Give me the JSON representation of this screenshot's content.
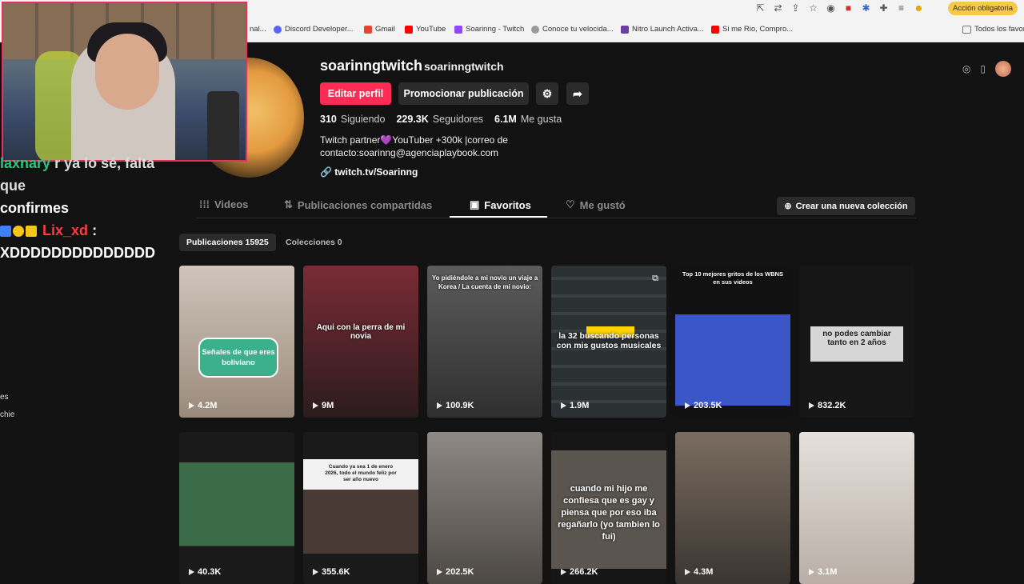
{
  "browser": {
    "action_label": "Acción obligatoria",
    "bookmarks": [
      {
        "label": "nal...",
        "color": "#888"
      },
      {
        "label": "Discord Developer...",
        "color": "#5865f2"
      },
      {
        "label": "Gmail",
        "color": "#ea4335"
      },
      {
        "label": "YouTube",
        "color": "#ff0000"
      },
      {
        "label": "Soarinng - Twitch",
        "color": "#9146ff"
      },
      {
        "label": "Conoce tu velocida...",
        "color": "#999"
      },
      {
        "label": "Nitro Launch Activa...",
        "color": "#6b3fa0"
      },
      {
        "label": "Si me Rio, Compro...",
        "color": "#ff0000"
      },
      {
        "label": "Todos los favori",
        "color": "#777"
      }
    ]
  },
  "chat": {
    "line1_tail": "r ya lo sé, falta que",
    "line2": "confirmes",
    "user2": "Lix_xd",
    "colon": ":",
    "message2": "XDDDDDDDDDDDDDD",
    "side_frag1": "es",
    "side_frag2": "chie"
  },
  "profile": {
    "username": "soarinngtwitch",
    "handle": "soarinngtwitch",
    "edit_label": "Editar perfil",
    "promote_label": "Promocionar publicación",
    "following_count": "310",
    "following_label": "Siguiendo",
    "followers_count": "229.3K",
    "followers_label": "Seguidores",
    "likes_count": "6.1M",
    "likes_label": "Me gusta",
    "bio_line1": "Twitch partner💜YouTuber +300k |correo de",
    "bio_line2": "contacto:soarinng@agenciaplaybook.com",
    "link": "twitch.tv/Soarinng"
  },
  "tabs": {
    "videos": "Videos",
    "reposts": "Publicaciones compartidas",
    "favorites": "Favoritos",
    "liked": "Me gustó",
    "new_collection": "Crear una nueva colección"
  },
  "subtabs": {
    "posts": "Publicaciones 15925",
    "collections": "Colecciones 0"
  },
  "videos": [
    {
      "views": "4.2M",
      "caption": "Señales de que eres boliviano",
      "bg": "#b59f8e"
    },
    {
      "views": "9M",
      "caption": "Aqui con la perra de mi novia",
      "bg": "#5a2a2f"
    },
    {
      "views": "100.9K",
      "caption": "Yo pidiéndole a mi novio un viaje a Korea / La cuenta de mi novio:",
      "bg": "#4b4b4b"
    },
    {
      "views": "1.9M",
      "caption": "la 32 buscando personas con mis gustos musicales",
      "bg": "#2f3436"
    },
    {
      "views": "203.5K",
      "caption": "Top 10 mejores gritos de los WBNS en sus videos",
      "bg": "#1b1b1b"
    },
    {
      "views": "832.2K",
      "caption": "no podes cambiar tanto en 2 años",
      "bg": "#151515"
    },
    {
      "views": "40.3K",
      "caption": "",
      "bg": "#1e1e1e"
    },
    {
      "views": "355.6K",
      "caption": "Cuando ya sea 1 de enero 2026, todo el mundo feliz por ser año nuevo",
      "bg": "#1a1a1a"
    },
    {
      "views": "202.5K",
      "caption": "",
      "bg": "#6e6a66"
    },
    {
      "views": "266.2K",
      "caption": "cuando mi hijo me confiesa que es gay y piensa que por eso iba regañarlo (yo tambien lo fui)",
      "bg": "#3a3a36"
    },
    {
      "views": "4.3M",
      "caption": "",
      "bg": "#5a5148"
    },
    {
      "views": "3.1M",
      "caption": "",
      "bg": "#cfc8c2"
    }
  ],
  "colors": {
    "accent": "#fe2c55",
    "background": "#121212",
    "button_gray": "#2b2b2b"
  }
}
